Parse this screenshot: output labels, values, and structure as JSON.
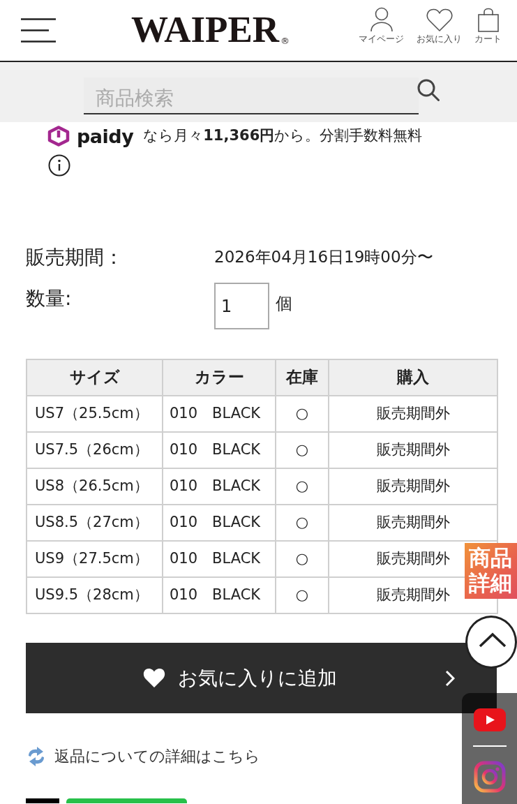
{
  "header": {
    "logo": "WAIPER",
    "logo_mark": "®",
    "nav": [
      {
        "kind": "account",
        "label": "マイページ"
      },
      {
        "kind": "favorites",
        "label": "お気に入り"
      },
      {
        "kind": "cart",
        "label": "カート"
      }
    ]
  },
  "search": {
    "placeholder": "商品検索"
  },
  "paidy": {
    "brand": "paidy",
    "text": "なら月々**11,366円**から。分割手数料無料"
  },
  "sale_period": {
    "label": "販売期間：",
    "value": "2026年04月16日19時00分〜"
  },
  "quantity": {
    "label": "数量:",
    "value": "1",
    "unit": "個"
  },
  "table": {
    "columns": [
      "サイズ",
      "カラー",
      "在庫",
      "購入"
    ],
    "rows": [
      [
        "US7（25.5cm）",
        "010　BLACK",
        "○",
        "販売期間外"
      ],
      [
        "US7.5（26cm）",
        "010　BLACK",
        "○",
        "販売期間外"
      ],
      [
        "US8（26.5cm）",
        "010　BLACK",
        "○",
        "販売期間外"
      ],
      [
        "US8.5（27cm）",
        "010　BLACK",
        "○",
        "販売期間外"
      ],
      [
        "US9（27.5cm）",
        "010　BLACK",
        "○",
        "販売期間外"
      ],
      [
        "US9.5（28cm）",
        "010　BLACK",
        "○",
        "販売期間外"
      ]
    ]
  },
  "favorite_button": {
    "label": "お気に入りに追加"
  },
  "return_link": {
    "label": "返品についての詳細はこちら"
  },
  "side_tab": {
    "label": "商品詳細"
  }
}
